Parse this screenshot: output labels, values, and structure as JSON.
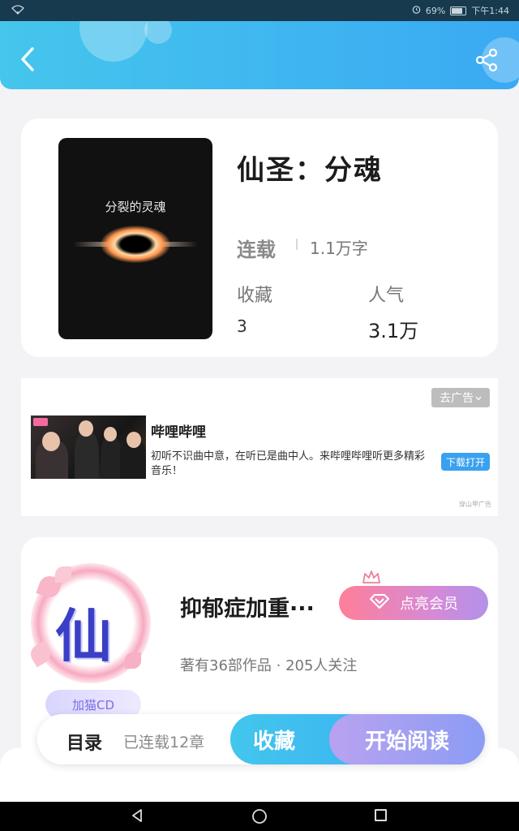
{
  "status_bar": {
    "battery": "69%",
    "time": "下午1:44"
  },
  "book": {
    "cover_text": "分裂的灵魂",
    "title": "仙圣：分魂",
    "status": "连载",
    "word_count": "1.1万字",
    "favorites_label": "收藏",
    "favorites_value": "3",
    "popularity_label": "人气",
    "popularity_value": "3.1万"
  },
  "ad": {
    "close_label": "去广告",
    "title": "哔哩哔哩",
    "description": "初听不识曲中意，在听已是曲中人。来哔哩哔哩听更多精彩音乐！",
    "download_label": "下载打开",
    "source": "穿山甲广告"
  },
  "author": {
    "avatar_char": "仙",
    "badge": "加猫CD",
    "name": "抑郁症加重···",
    "vip_label": "点亮会员",
    "stats": "著有36部作品 · 205人关注"
  },
  "action_bar": {
    "toc_label": "目录",
    "chapter_count": "已连载12章",
    "favorite_label": "收藏",
    "read_label": "开始阅读"
  },
  "icons": {
    "back": "chevron-left-icon",
    "share": "share-icon",
    "vip": "diamond-icon",
    "crown": "crown-icon"
  },
  "colors": {
    "header_start": "#45c6ec",
    "header_end": "#3aa9f3",
    "favorite_button": "#42c6ec",
    "read_button": "#a89ff2",
    "vip_button_start": "#ff7f98",
    "vip_button_end": "#b391e9"
  }
}
